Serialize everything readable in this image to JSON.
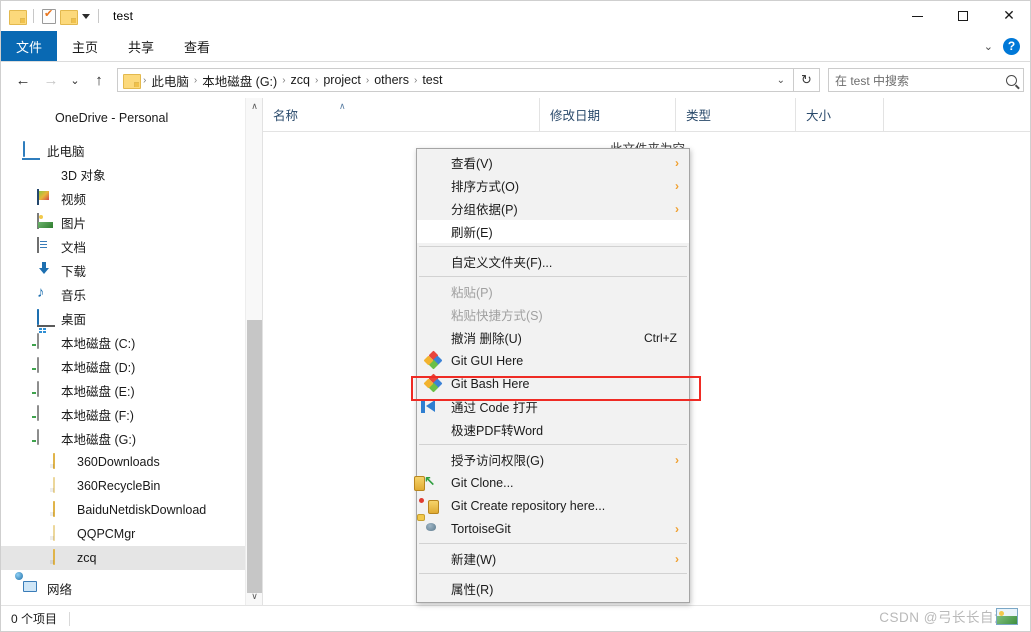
{
  "window": {
    "title": "test",
    "quick_access": [
      "folder-icon",
      "properties-icon",
      "new-folder-icon",
      "customize-caret"
    ],
    "controls": {
      "minimize": "—",
      "maximize": "□",
      "close": "✕"
    }
  },
  "ribbon": {
    "tabs": [
      {
        "label": "文件",
        "active": true
      },
      {
        "label": "主页",
        "active": false
      },
      {
        "label": "共享",
        "active": false
      },
      {
        "label": "查看",
        "active": false
      }
    ],
    "collapse_icon": "chevron-down-icon",
    "help_icon": "?"
  },
  "navigation": {
    "back_icon": "←",
    "forward_icon": "→",
    "recent_icon": "⌄",
    "up_icon": "↑",
    "breadcrumbs": [
      "此电脑",
      "本地磁盘 (G:)",
      "zcq",
      "project",
      "others",
      "test"
    ],
    "breadcrumb_separator": "›",
    "dropdown_icon": "⌄",
    "refresh_icon": "↻"
  },
  "search": {
    "placeholder": "在 test 中搜索",
    "value": "",
    "icon": "search-icon"
  },
  "sidebar": {
    "items": [
      {
        "label": "OneDrive - Personal",
        "icon": "onedrive-icon",
        "indent": 0,
        "selected": false
      },
      {
        "label": "此电脑",
        "icon": "this-pc-icon",
        "indent": 0,
        "selected": false
      },
      {
        "label": "3D 对象",
        "icon": "3d-objects-icon",
        "indent": 1,
        "selected": false
      },
      {
        "label": "视频",
        "icon": "videos-icon",
        "indent": 1,
        "selected": false
      },
      {
        "label": "图片",
        "icon": "pictures-icon",
        "indent": 1,
        "selected": false
      },
      {
        "label": "文档",
        "icon": "documents-icon",
        "indent": 1,
        "selected": false
      },
      {
        "label": "下载",
        "icon": "downloads-icon",
        "indent": 1,
        "selected": false
      },
      {
        "label": "音乐",
        "icon": "music-icon",
        "indent": 1,
        "selected": false
      },
      {
        "label": "桌面",
        "icon": "desktop-icon",
        "indent": 1,
        "selected": false
      },
      {
        "label": "本地磁盘 (C:)",
        "icon": "system-drive-icon",
        "indent": 1,
        "selected": false
      },
      {
        "label": "本地磁盘 (D:)",
        "icon": "drive-icon",
        "indent": 1,
        "selected": false
      },
      {
        "label": "本地磁盘 (E:)",
        "icon": "drive-icon",
        "indent": 1,
        "selected": false
      },
      {
        "label": "本地磁盘 (F:)",
        "icon": "drive-icon",
        "indent": 1,
        "selected": false
      },
      {
        "label": "本地磁盘 (G:)",
        "icon": "drive-icon",
        "indent": 1,
        "selected": false
      },
      {
        "label": "360Downloads",
        "icon": "folder-icon",
        "indent": 2,
        "selected": false
      },
      {
        "label": "360RecycleBin",
        "icon": "folder-empty-icon",
        "indent": 2,
        "selected": false
      },
      {
        "label": "BaiduNetdiskDownload",
        "icon": "folder-icon",
        "indent": 2,
        "selected": false
      },
      {
        "label": "QQPCMgr",
        "icon": "folder-empty-icon",
        "indent": 2,
        "selected": false
      },
      {
        "label": "zcq",
        "icon": "folder-icon",
        "indent": 2,
        "selected": true
      },
      {
        "label": "网络",
        "icon": "network-icon",
        "indent": 0,
        "selected": false
      }
    ],
    "scrollbar": {
      "up_arrow": "∧",
      "down_arrow": "∨"
    }
  },
  "file_list": {
    "columns": [
      {
        "label": "名称",
        "sorted": true,
        "sort_icon": "∧"
      },
      {
        "label": "修改日期",
        "sorted": false
      },
      {
        "label": "类型",
        "sorted": false
      },
      {
        "label": "大小",
        "sorted": false
      }
    ],
    "empty_message": "此文件夹为空",
    "rows": []
  },
  "context_menu": {
    "items": [
      {
        "label": "查看(V)",
        "icon": null,
        "submenu": true,
        "disabled": false,
        "accel": null,
        "highlighted": false
      },
      {
        "label": "排序方式(O)",
        "icon": null,
        "submenu": true,
        "disabled": false,
        "accel": null,
        "highlighted": false
      },
      {
        "label": "分组依据(P)",
        "icon": null,
        "submenu": true,
        "disabled": false,
        "accel": null,
        "highlighted": false
      },
      {
        "label": "刷新(E)",
        "icon": null,
        "submenu": false,
        "disabled": false,
        "accel": null,
        "highlighted": false,
        "white_bg": true
      },
      {
        "separator": true
      },
      {
        "label": "自定义文件夹(F)...",
        "icon": null,
        "submenu": false,
        "disabled": false,
        "accel": null,
        "highlighted": false
      },
      {
        "separator": true
      },
      {
        "label": "粘贴(P)",
        "icon": null,
        "submenu": false,
        "disabled": true,
        "accel": null,
        "highlighted": false
      },
      {
        "label": "粘贴快捷方式(S)",
        "icon": null,
        "submenu": false,
        "disabled": true,
        "accel": null,
        "highlighted": false
      },
      {
        "label": "撤消 删除(U)",
        "icon": null,
        "submenu": false,
        "disabled": false,
        "accel": "Ctrl+Z",
        "highlighted": false
      },
      {
        "label": "Git GUI Here",
        "icon": "git-icon",
        "submenu": false,
        "disabled": false,
        "accel": null,
        "highlighted": false
      },
      {
        "label": "Git Bash Here",
        "icon": "git-icon",
        "submenu": false,
        "disabled": false,
        "accel": null,
        "highlighted": true
      },
      {
        "label": "通过 Code 打开",
        "icon": "vscode-icon",
        "submenu": false,
        "disabled": false,
        "accel": null,
        "highlighted": false
      },
      {
        "label": "极速PDF转Word",
        "icon": null,
        "submenu": false,
        "disabled": false,
        "accel": null,
        "highlighted": false
      },
      {
        "separator": true
      },
      {
        "label": "授予访问权限(G)",
        "icon": null,
        "submenu": true,
        "disabled": false,
        "accel": null,
        "highlighted": false
      },
      {
        "label": "Git Clone...",
        "icon": "git-clone-icon",
        "submenu": false,
        "disabled": false,
        "accel": null,
        "highlighted": false
      },
      {
        "label": "Git Create repository here...",
        "icon": "git-create-icon",
        "submenu": false,
        "disabled": false,
        "accel": null,
        "highlighted": false
      },
      {
        "label": "TortoiseGit",
        "icon": "tortoisegit-icon",
        "submenu": true,
        "disabled": false,
        "accel": null,
        "highlighted": false
      },
      {
        "separator": true
      },
      {
        "label": "新建(W)",
        "icon": null,
        "submenu": true,
        "disabled": false,
        "accel": null,
        "highlighted": false
      },
      {
        "separator": true
      },
      {
        "label": "属性(R)",
        "icon": null,
        "submenu": false,
        "disabled": false,
        "accel": null,
        "highlighted": false
      }
    ],
    "submenu_arrow": "›",
    "highlight_color": "#ef2b24"
  },
  "status_bar": {
    "item_count": "0 个项目"
  },
  "watermark": {
    "text": "CSDN @弓长长自治"
  },
  "colors": {
    "accent": "#0969b3",
    "highlight": "#ef2b24",
    "selection": "#e5e5e5",
    "column_header_text": "#2a4a6b"
  }
}
